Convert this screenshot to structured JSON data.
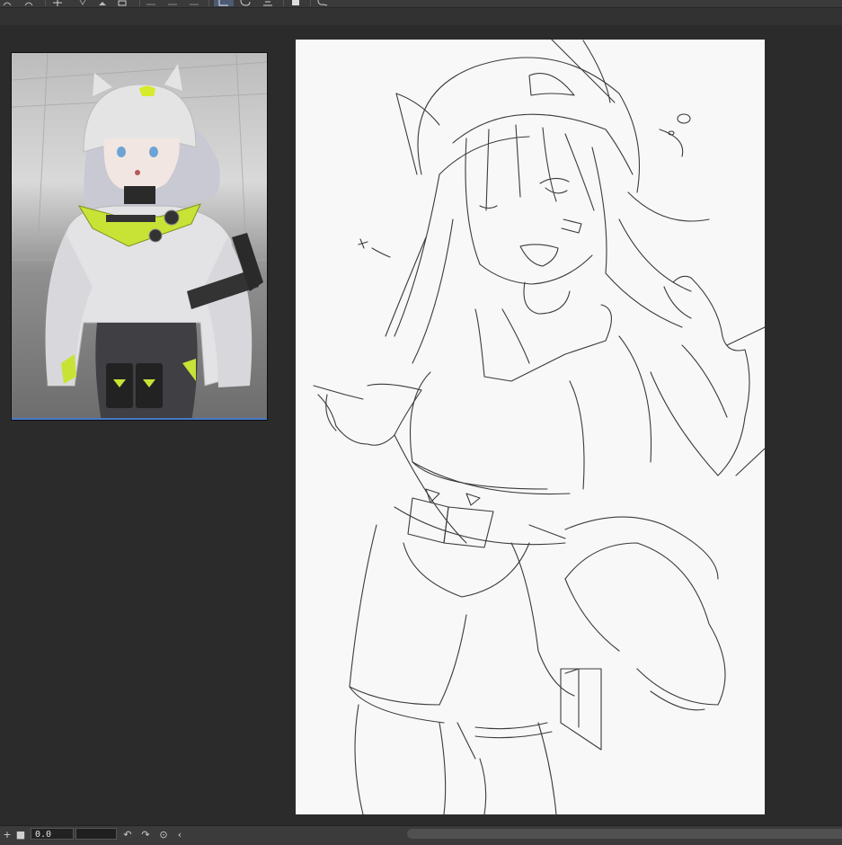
{
  "toolbar": {
    "icons": [
      "undo-icon",
      "redo-icon",
      "transform-icon",
      "fill-icon",
      "ruler-icon",
      "layer-icon",
      "selection-icon",
      "rotate-icon",
      "flip-icon",
      "save-icon",
      "comment-icon"
    ]
  },
  "status": {
    "zoom_value": "0.0"
  },
  "colors": {
    "accent": "#4a78c8",
    "lime": "#c8e336",
    "canvas": "#f8f8f8"
  }
}
